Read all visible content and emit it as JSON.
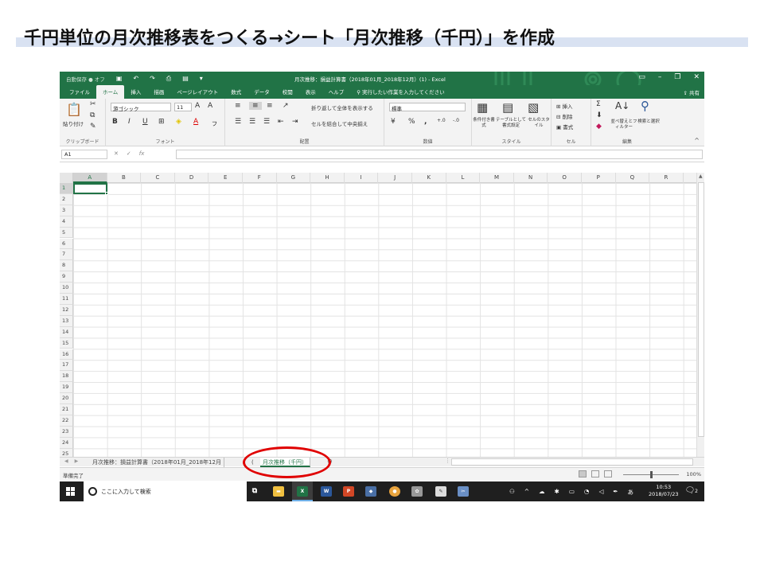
{
  "slide": {
    "title": "千円単位の月次推移表をつくる→シート「月次推移（千円）」を作成",
    "accent_color": "#d9e2f2",
    "annotation_color": "#e00000"
  },
  "excel": {
    "brand_color": "#217346",
    "autosave_label": "自動保存 ● オフ",
    "doc_title": "月次推移：損益計算書（2018年01月_2018年12月）(1) - Excel",
    "tabs": [
      "ファイル",
      "ホーム",
      "挿入",
      "描画",
      "ページレイアウト",
      "数式",
      "データ",
      "校閲",
      "表示",
      "ヘルプ"
    ],
    "tell_me": "実行したい作業を入力してください",
    "share_label": "共有",
    "ribbon": {
      "clipboard": {
        "label": "クリップボード",
        "paste": "貼り付け"
      },
      "font": {
        "label": "フォント",
        "font_name": "游ゴシック",
        "font_size": "11"
      },
      "alignment": {
        "label": "配置",
        "wrap_text": "折り返して全体を表示する",
        "merge_center": "セルを結合して中央揃え"
      },
      "number": {
        "label": "数値",
        "format": "標準"
      },
      "styles": {
        "label": "スタイル",
        "conditional": "条件付き書式",
        "table": "テーブルとして書式設定",
        "cell_styles": "セルのスタイル"
      },
      "cells": {
        "label": "セル",
        "insert": "挿入",
        "delete": "削除",
        "format": "書式"
      },
      "editing": {
        "label": "編集",
        "sort_filter": "並べ替えとフィルター",
        "find_select": "検索と選択"
      }
    },
    "name_box": "A1",
    "fx_label": "fx",
    "columns": [
      "A",
      "B",
      "C",
      "D",
      "E",
      "F",
      "G",
      "H",
      "I",
      "J",
      "K",
      "L",
      "M",
      "N",
      "O",
      "P",
      "Q",
      "R"
    ],
    "rows": [
      "1",
      "2",
      "3",
      "4",
      "5",
      "6",
      "7",
      "8",
      "9",
      "10",
      "11",
      "12",
      "13",
      "14",
      "15",
      "16",
      "17",
      "18",
      "19",
      "20",
      "21",
      "22",
      "23",
      "24",
      "25"
    ],
    "sheets": [
      {
        "name": "月次推移：損益計算書（2018年01月_2018年12月",
        "active": false
      },
      {
        "name": "(",
        "active": false
      },
      {
        "name": "月次推移（千円）",
        "active": true
      }
    ],
    "add_sheet": "⊕",
    "status_ready": "準備完了",
    "zoom": "100%"
  },
  "taskbar": {
    "search_placeholder": "ここに入力して検索",
    "time": "10:53",
    "date": "2018/07/23",
    "ime": "あ",
    "notification_count": "2"
  }
}
